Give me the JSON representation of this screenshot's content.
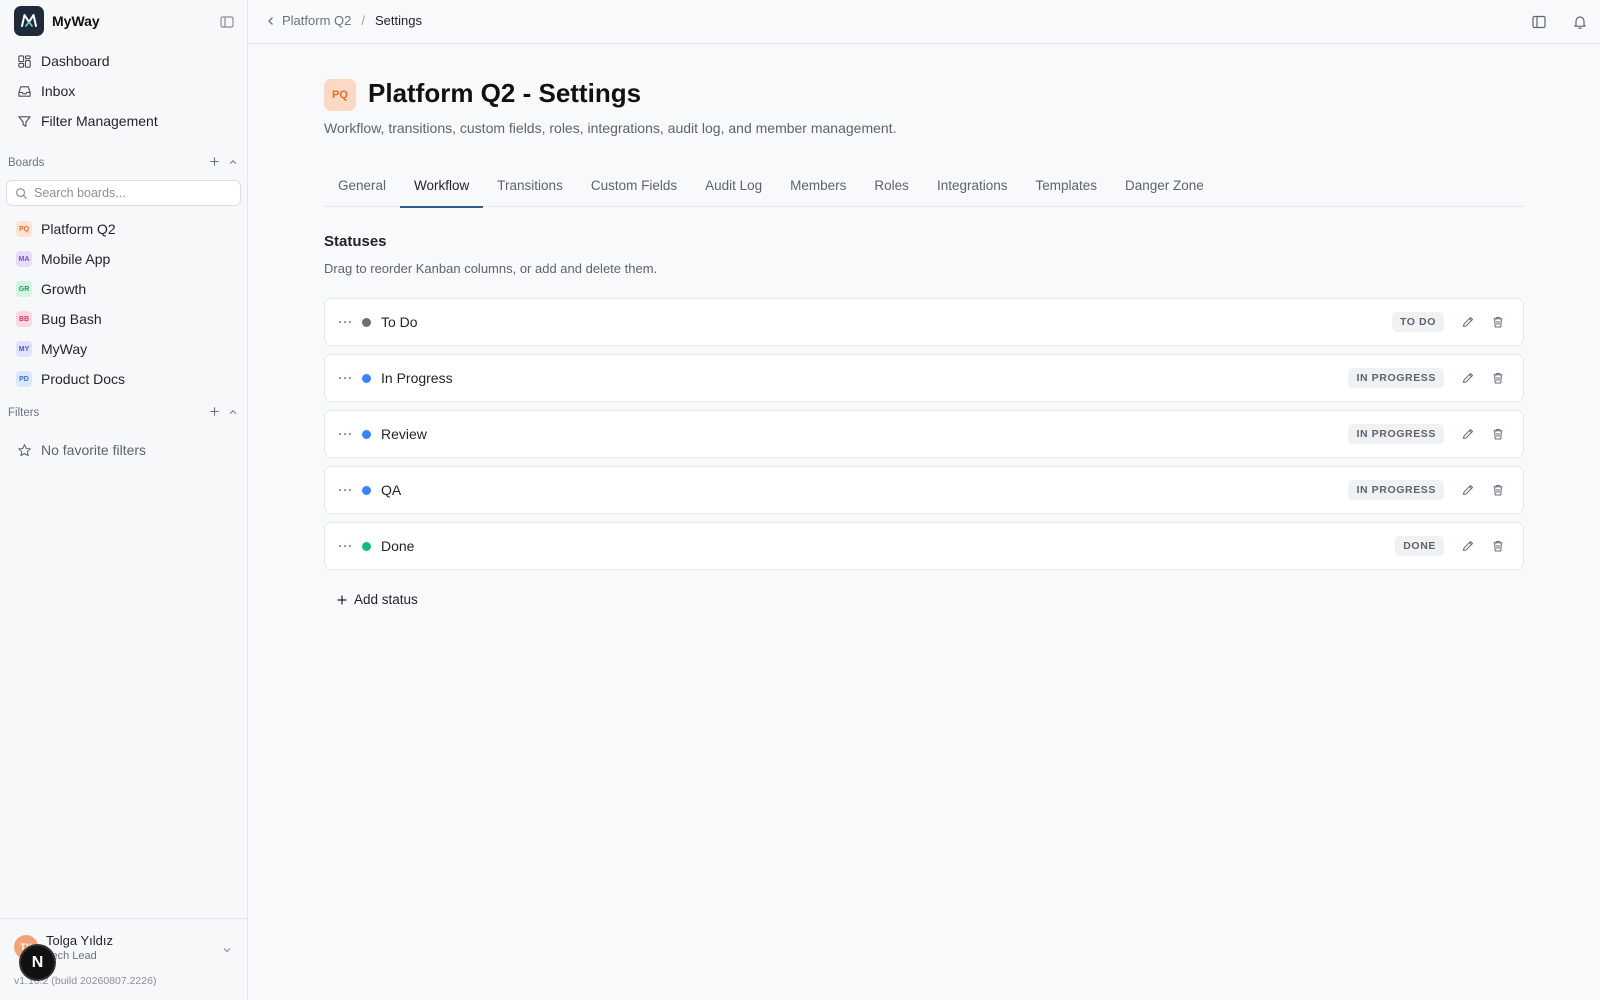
{
  "app": {
    "name": "MyWay"
  },
  "sidebar": {
    "nav": [
      {
        "label": "Dashboard",
        "icon": "dashboard-icon"
      },
      {
        "label": "Inbox",
        "icon": "inbox-icon"
      },
      {
        "label": "Filter Management",
        "icon": "filter-icon"
      }
    ],
    "boards_label": "Boards",
    "search_placeholder": "Search boards...",
    "boards": [
      {
        "badge": "PQ",
        "label": "Platform Q2",
        "bg": "#fde3d3",
        "fg": "#e66a2c"
      },
      {
        "badge": "MA",
        "label": "Mobile App",
        "bg": "#e7dcfb",
        "fg": "#7c4bd8"
      },
      {
        "badge": "GR",
        "label": "Growth",
        "bg": "#d6f2e3",
        "fg": "#1f9d5c"
      },
      {
        "badge": "BB",
        "label": "Bug Bash",
        "bg": "#fbd9e1",
        "fg": "#d6336c"
      },
      {
        "badge": "MY",
        "label": "MyWay",
        "bg": "#e1e3fb",
        "fg": "#4a51c9"
      },
      {
        "badge": "PD",
        "label": "Product Docs",
        "bg": "#dbe8fb",
        "fg": "#2f6fce"
      }
    ],
    "filters_label": "Filters",
    "no_filters": "No favorite filters",
    "user": {
      "initials": "TY",
      "name": "Tolga Yıldız",
      "role": "Tech Lead"
    },
    "version": "v1.10.2 (build 20260807.2226)",
    "next_badge": "N"
  },
  "breadcrumb": {
    "parent": "Platform Q2",
    "separator": "/",
    "current": "Settings"
  },
  "page": {
    "badge": "PQ",
    "title": "Platform Q2 - Settings",
    "subtitle": "Workflow, transitions, custom fields, roles, integrations, audit log, and member management."
  },
  "tabs": [
    "General",
    "Workflow",
    "Transitions",
    "Custom Fields",
    "Audit Log",
    "Members",
    "Roles",
    "Integrations",
    "Templates",
    "Danger Zone"
  ],
  "active_tab": "Workflow",
  "statuses_section": {
    "title": "Statuses",
    "subtitle": "Drag to reorder Kanban columns, or add and delete them.",
    "items": [
      {
        "name": "To Do",
        "category": "TO DO",
        "color": "#6b6f76"
      },
      {
        "name": "In Progress",
        "category": "IN PROGRESS",
        "color": "#3b82f6"
      },
      {
        "name": "Review",
        "category": "IN PROGRESS",
        "color": "#3b82f6"
      },
      {
        "name": "QA",
        "category": "IN PROGRESS",
        "color": "#3b82f6"
      },
      {
        "name": "Done",
        "category": "DONE",
        "color": "#10b981"
      }
    ],
    "add_label": "Add status"
  }
}
